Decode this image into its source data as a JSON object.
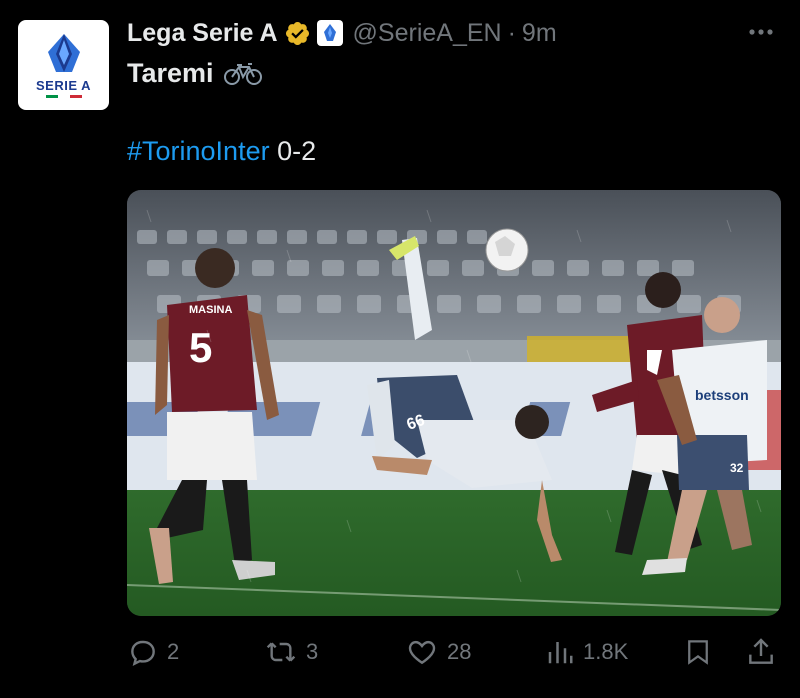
{
  "account": {
    "name": "Lega Serie A",
    "handle": "@SerieA_EN",
    "separator": "·",
    "time": "9m",
    "avatar_text": "SERIE A"
  },
  "tweet": {
    "line1": "Taremi",
    "hashtag": "#TorinoInter",
    "score": " 0-2"
  },
  "photo": {
    "player_left_name": "MASINA",
    "player_left_number": "5",
    "player_center_number": "66",
    "player_right_sponsor": "betsson",
    "player_right_number": "32"
  },
  "actions": {
    "replies": "2",
    "retweets": "3",
    "likes": "28",
    "views": "1.8K"
  },
  "colors": {
    "background": "#000000",
    "text": "#e7e9ea",
    "muted": "#71767b",
    "link": "#1d9bf0",
    "verified_gold": "#e8b829"
  }
}
